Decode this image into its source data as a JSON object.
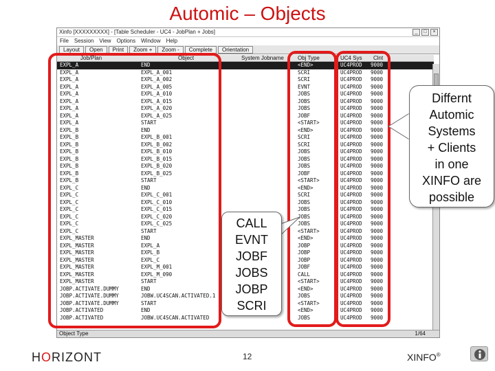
{
  "slide": {
    "title": "Automic – Objects",
    "page_number": "12",
    "logo_h": "H",
    "logo_o": "O",
    "logo_rest": "RIZONT",
    "product": "XINFO",
    "product_mark": "®"
  },
  "window": {
    "title": "Xinfo [XXXXXXXXX] - [Table Scheduler - UC4 - JobPlan + Jobs]",
    "menu": [
      "File",
      "Session",
      "View",
      "Options",
      "Window",
      "Help"
    ],
    "toolbar": [
      "Layout",
      "Open",
      "Print",
      "Zoom +",
      "Zoom -",
      "Complete",
      "Orientation"
    ],
    "columns": [
      "Job/Plan",
      "Object",
      "System Jobname",
      "Obj Type",
      "UC4 Sys",
      "Clnt"
    ],
    "status_left": "Object Type",
    "status_right": "1/64"
  },
  "rows": [
    {
      "job": "EXPL_A",
      "obj": "END",
      "type": "<END>",
      "sys": "UC4PROD",
      "clnt": "9000",
      "selected": true
    },
    {
      "job": "EXPL_A",
      "obj": "EXPL_A_001",
      "type": "SCRI",
      "sys": "UC4PROD",
      "clnt": "9000"
    },
    {
      "job": "EXPL_A",
      "obj": "EXPL_A_002",
      "type": "SCRI",
      "sys": "UC4PROD",
      "clnt": "9000"
    },
    {
      "job": "EXPL_A",
      "obj": "EXPL_A_005",
      "type": "EVNT",
      "sys": "UC4PROD",
      "clnt": "9000"
    },
    {
      "job": "EXPL_A",
      "obj": "EXPL_A_010",
      "type": "JOBS",
      "sys": "UC4PROD",
      "clnt": "9000"
    },
    {
      "job": "EXPL_A",
      "obj": "EXPL_A_015",
      "type": "JOBS",
      "sys": "UC4PROD",
      "clnt": "9000"
    },
    {
      "job": "EXPL_A",
      "obj": "EXPL_A_020",
      "type": "JOBS",
      "sys": "UC4PROD",
      "clnt": "9000"
    },
    {
      "job": "EXPL_A",
      "obj": "EXPL_A_025",
      "type": "JOBF",
      "sys": "UC4PROD",
      "clnt": "9000"
    },
    {
      "job": "EXPL_A",
      "obj": "START",
      "type": "<START>",
      "sys": "UC4PROD",
      "clnt": "9000"
    },
    {
      "job": "EXPL_B",
      "obj": "END",
      "type": "<END>",
      "sys": "UC4PROD",
      "clnt": "9000"
    },
    {
      "job": "EXPL_B",
      "obj": "EXPL_B_001",
      "type": "SCRI",
      "sys": "UC4PROD",
      "clnt": "9000"
    },
    {
      "job": "EXPL_B",
      "obj": "EXPL_B_002",
      "type": "SCRI",
      "sys": "UC4PROD",
      "clnt": "9000"
    },
    {
      "job": "EXPL_B",
      "obj": "EXPL_B_010",
      "type": "JOBS",
      "sys": "UC4PROD",
      "clnt": "9000"
    },
    {
      "job": "EXPL_B",
      "obj": "EXPL_B_015",
      "type": "JOBS",
      "sys": "UC4PROD",
      "clnt": "9000"
    },
    {
      "job": "EXPL_B",
      "obj": "EXPL_B_020",
      "type": "JOBS",
      "sys": "UC4PROD",
      "clnt": "9000"
    },
    {
      "job": "EXPL_B",
      "obj": "EXPL_B_025",
      "type": "JOBF",
      "sys": "UC4PROD",
      "clnt": "9000"
    },
    {
      "job": "EXPL_B",
      "obj": "START",
      "type": "<START>",
      "sys": "UC4PROD",
      "clnt": "9000"
    },
    {
      "job": "EXPL_C",
      "obj": "END",
      "type": "<END>",
      "sys": "UC4PROD",
      "clnt": "9000"
    },
    {
      "job": "EXPL_C",
      "obj": "EXPL_C_001",
      "type": "SCRI",
      "sys": "UC4PROD",
      "clnt": "9000"
    },
    {
      "job": "EXPL_C",
      "obj": "EXPL_C_010",
      "type": "JOBS",
      "sys": "UC4PROD",
      "clnt": "9000"
    },
    {
      "job": "EXPL_C",
      "obj": "EXPL_C_015",
      "type": "JOBS",
      "sys": "UC4PROD",
      "clnt": "9000"
    },
    {
      "job": "EXPL_C",
      "obj": "EXPL_C_020",
      "type": "JOBS",
      "sys": "UC4PROD",
      "clnt": "9000"
    },
    {
      "job": "EXPL_C",
      "obj": "EXPL_C_025",
      "type": "JOBS",
      "sys": "UC4PROD",
      "clnt": "9000"
    },
    {
      "job": "EXPL_C",
      "obj": "START",
      "type": "<START>",
      "sys": "UC4PROD",
      "clnt": "9000"
    },
    {
      "job": "EXPL_MASTER",
      "obj": "END",
      "type": "<END>",
      "sys": "UC4PROD",
      "clnt": "9000"
    },
    {
      "job": "EXPL_MASTER",
      "obj": "EXPL_A",
      "type": "JOBP",
      "sys": "UC4PROD",
      "clnt": "9000"
    },
    {
      "job": "EXPL_MASTER",
      "obj": "EXPL_B",
      "type": "JOBP",
      "sys": "UC4PROD",
      "clnt": "9000"
    },
    {
      "job": "EXPL_MASTER",
      "obj": "EXPL_C",
      "type": "JOBP",
      "sys": "UC4PROD",
      "clnt": "9000"
    },
    {
      "job": "EXPL_MASTER",
      "obj": "EXPL_M_001",
      "type": "JOBF",
      "sys": "UC4PROD",
      "clnt": "9000"
    },
    {
      "job": "EXPL_MASTER",
      "obj": "EXPL_M_090",
      "type": "CALL",
      "sys": "UC4PROD",
      "clnt": "9000"
    },
    {
      "job": "EXPL_MASTER",
      "obj": "START",
      "type": "<START>",
      "sys": "UC4PROD",
      "clnt": "9000"
    },
    {
      "job": "JOBP.ACTIVATE.DUMMY",
      "obj": "END",
      "type": "<END>",
      "sys": "UC4PROD",
      "clnt": "9000"
    },
    {
      "job": "JOBP.ACTIVATE.DUMMY",
      "obj": "JOBW.UC4SCAN.ACTIVATED.1",
      "type": "JOBS",
      "sys": "UC4PROD",
      "clnt": "9000"
    },
    {
      "job": "JOBP.ACTIVATE.DUMMY",
      "obj": "START",
      "type": "<START>",
      "sys": "UC4PROD",
      "clnt": "9000"
    },
    {
      "job": "JOBP.ACTIVATED",
      "obj": "END",
      "type": "<END>",
      "sys": "UC4PROD",
      "clnt": "9000"
    },
    {
      "job": "JOBP.ACTIVATED",
      "obj": "JOBW.UC4SCAN.ACTIVATED",
      "type": "JOBS",
      "sys": "UC4PROD",
      "clnt": "9000"
    }
  ],
  "callout_types": [
    "CALL",
    "EVNT",
    "JOBF",
    "JOBS",
    "JOBP",
    "SCRI"
  ],
  "callout_systems": [
    "Differnt",
    "Automic",
    "Systems",
    "+ Clients",
    "in one",
    "XINFO are",
    "possible"
  ],
  "colors": {
    "title": "#cc1111",
    "highlight": "#e21b1b"
  }
}
